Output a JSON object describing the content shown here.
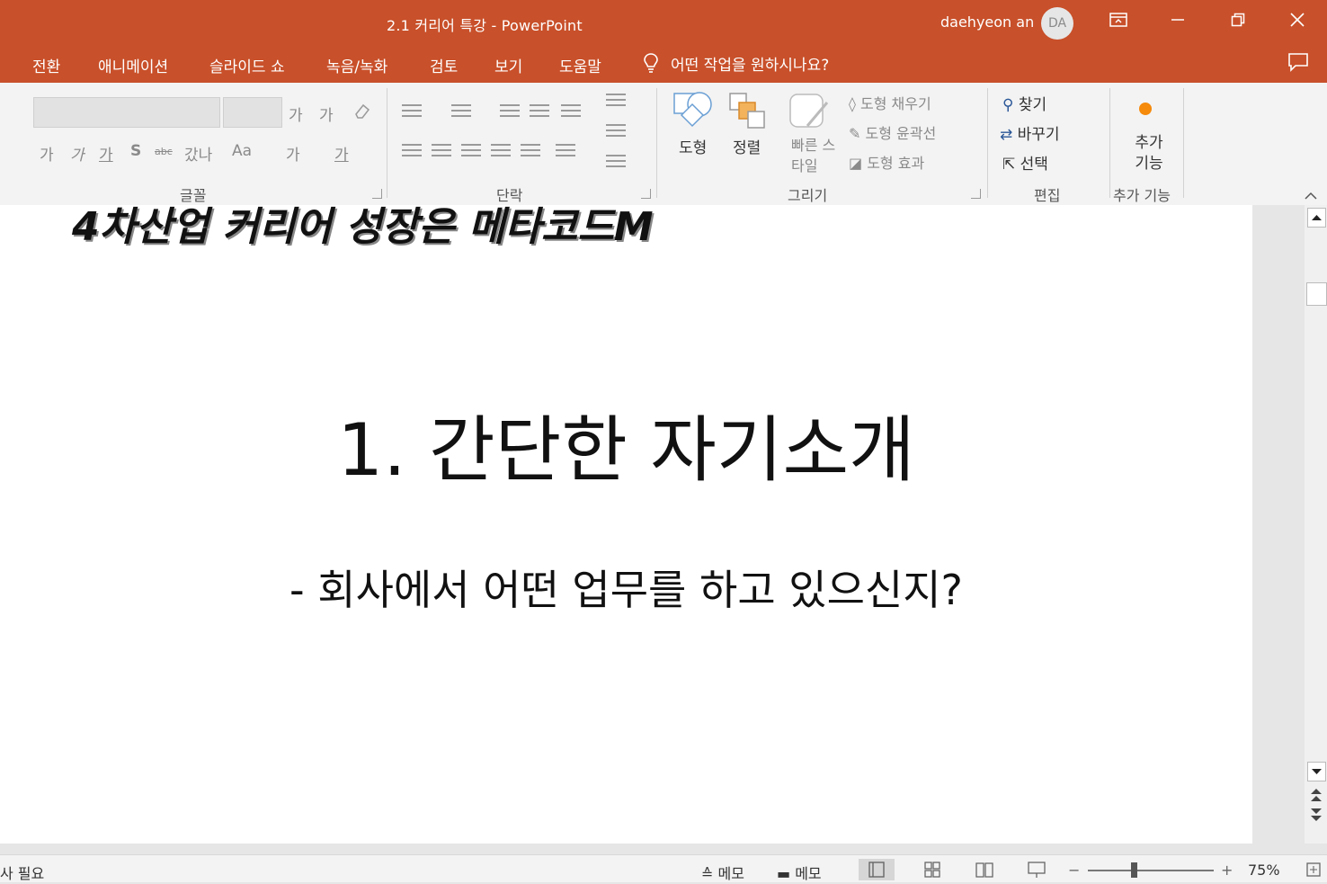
{
  "window": {
    "title": "2.1 커리어 특강  -  PowerPoint",
    "user_name": "daehyeon an",
    "avatar_initials": "DA",
    "accent_color": "#c8502a"
  },
  "menu": {
    "items": [
      "전환",
      "애니메이션",
      "슬라이드 쇼",
      "녹음/녹화",
      "검토",
      "보기",
      "도움말"
    ],
    "tell_me": "어떤 작업을 원하시나요?"
  },
  "ribbon": {
    "font_group": {
      "label": "글꼴",
      "grow_label": "가",
      "shrink_label": "가",
      "bold_label": "가",
      "italic_label": "가",
      "underline_label": "가",
      "strike_label": "S",
      "spacing_label": "abc",
      "case_label": "Aa",
      "hanja_label": "갔나",
      "highlight_label": "가",
      "font_color_label": "가"
    },
    "paragraph_group": {
      "label": "단락"
    },
    "drawing_group": {
      "label": "그리기",
      "shapes_label": "도형",
      "arrange_label": "정렬",
      "quick_styles_label": "빠른 스타일",
      "shape_fill": "도형 채우기",
      "shape_outline": "도형 윤곽선",
      "shape_effects": "도형 효과"
    },
    "editing_group": {
      "label": "편집",
      "find": "찾기",
      "replace": "바꾸기",
      "select": "선택"
    },
    "addins_group": {
      "label": "추가 기능",
      "button": "추가 기능"
    }
  },
  "slide": {
    "banner": "4차산업 커리어 성장은 메타코드M",
    "title": "1. 간단한 자기소개",
    "body": "- 회사에서 어떤 업무를 하고 있으신지?"
  },
  "status": {
    "left_text": "사 필요",
    "notes_label": "메모",
    "comments_label": "메모",
    "zoom": "75%"
  }
}
